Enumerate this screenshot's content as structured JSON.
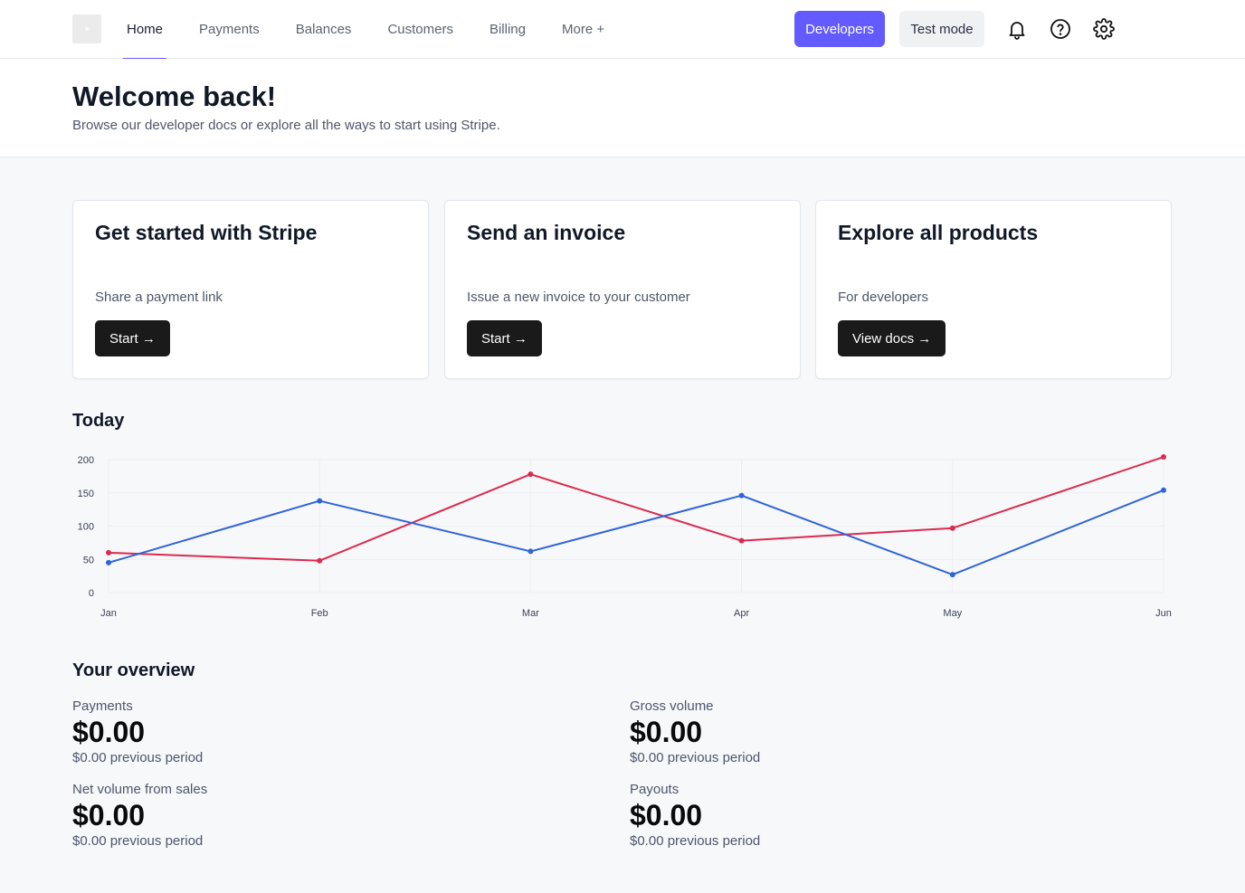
{
  "nav": {
    "items": [
      {
        "label": "Home",
        "active": true
      },
      {
        "label": "Payments",
        "active": false
      },
      {
        "label": "Balances",
        "active": false
      },
      {
        "label": "Customers",
        "active": false
      },
      {
        "label": "Billing",
        "active": false
      },
      {
        "label": "More +",
        "active": false
      }
    ],
    "developers_label": "Developers",
    "test_mode_label": "Test mode",
    "icons": [
      "bell-icon",
      "help-icon",
      "gear-icon"
    ]
  },
  "header": {
    "title": "Welcome back!",
    "subtitle": "Browse our developer docs or explore all the ways to start using Stripe."
  },
  "cards": [
    {
      "title": "Get started with Stripe",
      "description": "Share a payment link",
      "button": "Start →"
    },
    {
      "title": "Send an invoice",
      "description": "Issue a new invoice to your customer",
      "button": "Start →"
    },
    {
      "title": "Explore all products",
      "description": "For developers",
      "button": "View docs →"
    }
  ],
  "today": {
    "title": "Today"
  },
  "chart_data": {
    "type": "line",
    "categories": [
      "Jan",
      "Feb",
      "Mar",
      "Apr",
      "May",
      "Jun"
    ],
    "series": [
      {
        "color": "#dc2a4f",
        "values": [
          60,
          48,
          178,
          78,
          97,
          204
        ]
      },
      {
        "color": "#2f64d8",
        "values": [
          45,
          138,
          62,
          146,
          27,
          154
        ]
      }
    ],
    "yticks": [
      0,
      50,
      100,
      150,
      200
    ],
    "ylim": [
      0,
      200
    ],
    "grid": true
  },
  "overview": {
    "title": "Your overview",
    "metrics": [
      {
        "label": "Payments",
        "value": "$0.00",
        "previous": "$0.00 previous period"
      },
      {
        "label": "Gross volume",
        "value": "$0.00",
        "previous": "$0.00 previous period"
      },
      {
        "label": "Net volume from sales",
        "value": "$0.00",
        "previous": "$0.00 previous period"
      },
      {
        "label": "Payouts",
        "value": "$0.00",
        "previous": "$0.00 previous period"
      }
    ]
  },
  "colors": {
    "accent": "#635bff",
    "button_dark": "#1a1a1a",
    "background": "#f6f8fa"
  }
}
